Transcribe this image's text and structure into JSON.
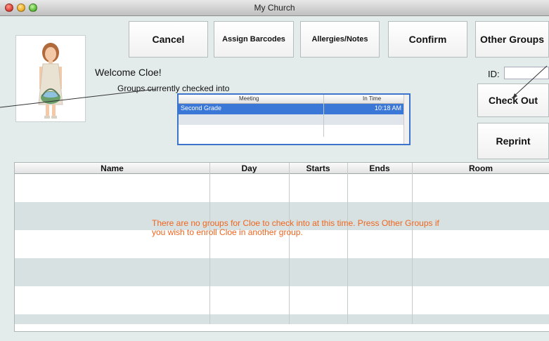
{
  "window": {
    "title": "My Church"
  },
  "toolbar": {
    "cancel_label": "Cancel",
    "assign_barcodes_label": "Assign Barcodes",
    "allergies_notes_label": "Allergies/Notes",
    "confirm_label": "Confirm",
    "other_groups_label": "Other Groups"
  },
  "welcome": {
    "text": "Welcome Cloe!",
    "groups_label": "Groups currently checked into"
  },
  "checked_in": {
    "columns": [
      "Meeting",
      "In Time"
    ],
    "rows": [
      {
        "meeting": "Second Grade",
        "in_time": "10:18 AM"
      }
    ]
  },
  "id_field": {
    "label": "ID:",
    "value": ""
  },
  "side_buttons": {
    "checkout_label": "Check Out",
    "reprint_label": "Reprint"
  },
  "groups_table": {
    "columns": [
      "Name",
      "Day",
      "Starts",
      "Ends",
      "Room"
    ],
    "empty_message": "There are no groups for Cloe to check into at this time.  Press Other Groups if you wish to enroll Cloe in another group."
  },
  "colors": {
    "selection": "#3a77d6",
    "message": "#f0651e",
    "alt_row": "#d7e1e1"
  }
}
